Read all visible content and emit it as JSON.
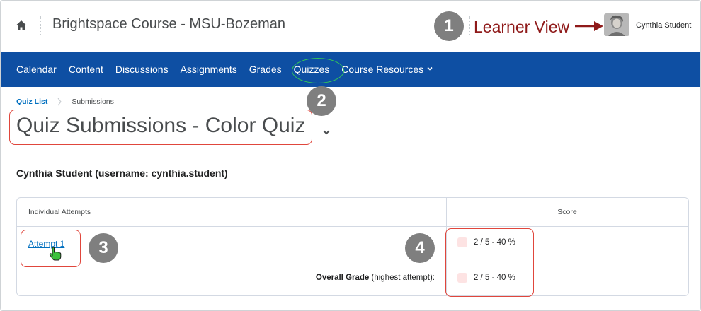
{
  "header": {
    "course_title": "Brightspace Course - MSU-Bozeman",
    "learner_view_label": "Learner View",
    "user_name": "Cynthia Student"
  },
  "callouts": {
    "one": "1",
    "two": "2",
    "three": "3",
    "four": "4"
  },
  "nav": {
    "items": [
      {
        "label": "Calendar"
      },
      {
        "label": "Content"
      },
      {
        "label": "Discussions"
      },
      {
        "label": "Assignments"
      },
      {
        "label": "Grades"
      },
      {
        "label": "Quizzes"
      },
      {
        "label": "Course Resources"
      }
    ]
  },
  "breadcrumb": {
    "link": "Quiz List",
    "current": "Submissions"
  },
  "page": {
    "title": "Quiz Submissions - Color Quiz",
    "student_heading": "Cynthia Student (username: cynthia.student)"
  },
  "table": {
    "headers": {
      "attempts": "Individual Attempts",
      "score": "Score"
    },
    "attempt": {
      "label": "Attempt 1",
      "score": "2 / 5 - 40 %"
    },
    "overall": {
      "label_bold": "Overall Grade",
      "label_rest": " (highest attempt):",
      "score": "2 / 5 - 40 %"
    }
  },
  "colors": {
    "nav_bg": "#0e4fa3",
    "link": "#006fbf",
    "callout_bg": "#7f7f7f",
    "annotation_red": "#e0463c",
    "annotation_green": "#34c759",
    "learner_view_text": "#8f1a1a",
    "score_badge": "#fde3e3"
  },
  "icons": {
    "home": "home-icon",
    "arrow": "arrow-right-icon",
    "avatar": "avatar",
    "course_resources_chevron": "chevron-down-icon",
    "breadcrumb_separator": "chevron-right-icon",
    "title_chevron": "chevron-down-icon",
    "cursor": "hand-pointer-icon"
  }
}
